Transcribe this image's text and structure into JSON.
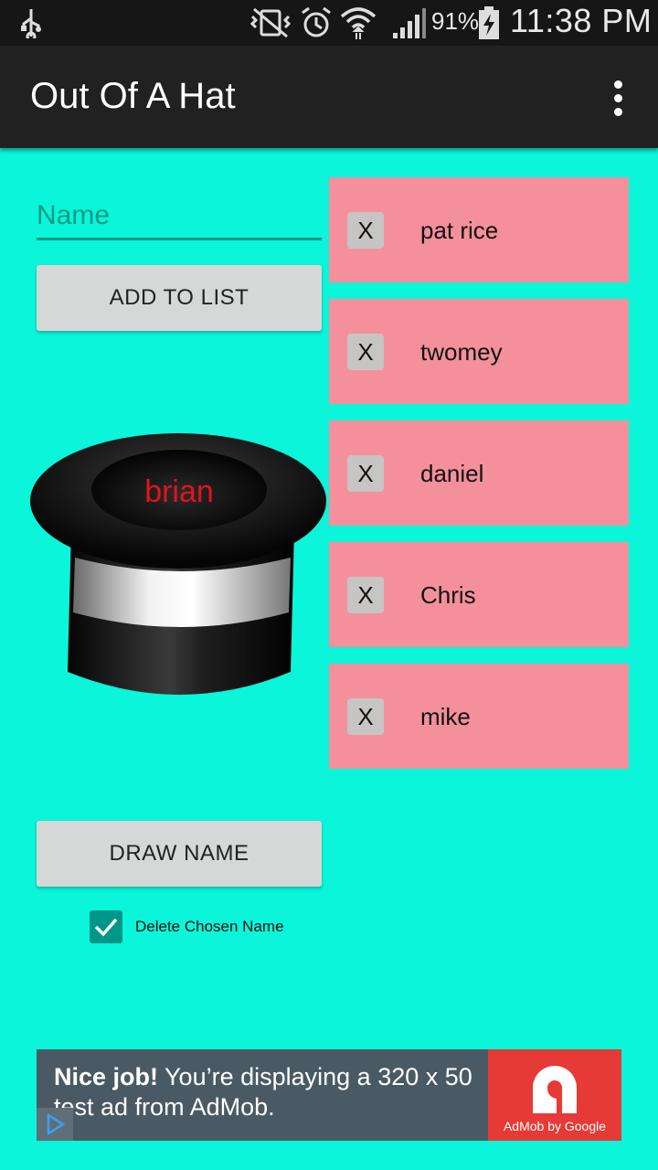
{
  "status_bar": {
    "battery_percent": "91%",
    "time": "11:38 PM"
  },
  "app_bar": {
    "title": "Out Of A Hat",
    "overflow_icon": "more-vert-icon"
  },
  "form": {
    "name_placeholder": "Name",
    "name_value": "",
    "add_button": "ADD TO LIST"
  },
  "hat": {
    "drawn_name": "brian"
  },
  "draw_button": "DRAW NAME",
  "delete_option": {
    "label": "Delete Chosen Name",
    "checked": true
  },
  "names": [
    {
      "remove": "X",
      "name": "pat rice"
    },
    {
      "remove": "X",
      "name": "twomey"
    },
    {
      "remove": "X",
      "name": "daniel"
    },
    {
      "remove": "X",
      "name": "Chris"
    },
    {
      "remove": "X",
      "name": "mike"
    }
  ],
  "ad": {
    "headline": "Nice job!",
    "body": " You’re displaying a 320 x 50 test ad from AdMob.",
    "logo_caption": "AdMob by Google"
  },
  "colors": {
    "background": "#0af5d9",
    "app_bar": "#212121",
    "list_item": "#f4909b",
    "accent": "#009688",
    "drawn_name": "#e0141e",
    "ad_background": "#4a5a64",
    "ad_logo": "#e53a35"
  }
}
